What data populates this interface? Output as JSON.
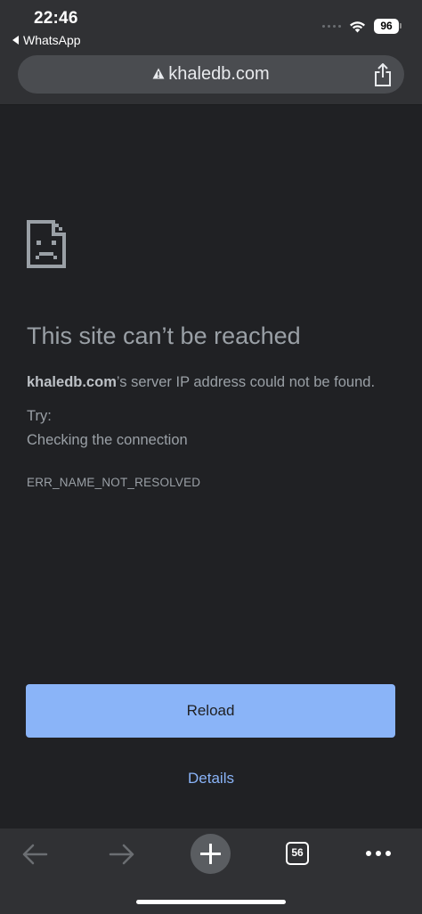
{
  "status_bar": {
    "time": "22:46",
    "back_app": "WhatsApp",
    "battery": "96"
  },
  "url_bar": {
    "url": "khaledb.com",
    "security_icon": "warning-triangle-icon",
    "share_icon": "share-icon"
  },
  "error_page": {
    "icon": "sad-page-icon",
    "title": "This site can’t be reached",
    "desc_host": "khaledb.com",
    "desc_rest": "’s server IP address could not be found.",
    "try_label": "Try:",
    "suggestion": "Checking the connection",
    "error_code": "ERR_NAME_NOT_RESOLVED",
    "reload_label": "Reload",
    "details_label": "Details"
  },
  "toolbar": {
    "tab_count": "56"
  },
  "colors": {
    "background": "#202124",
    "chrome": "#303134",
    "accent": "#8ab4f8",
    "text": "#9aa0a6"
  }
}
